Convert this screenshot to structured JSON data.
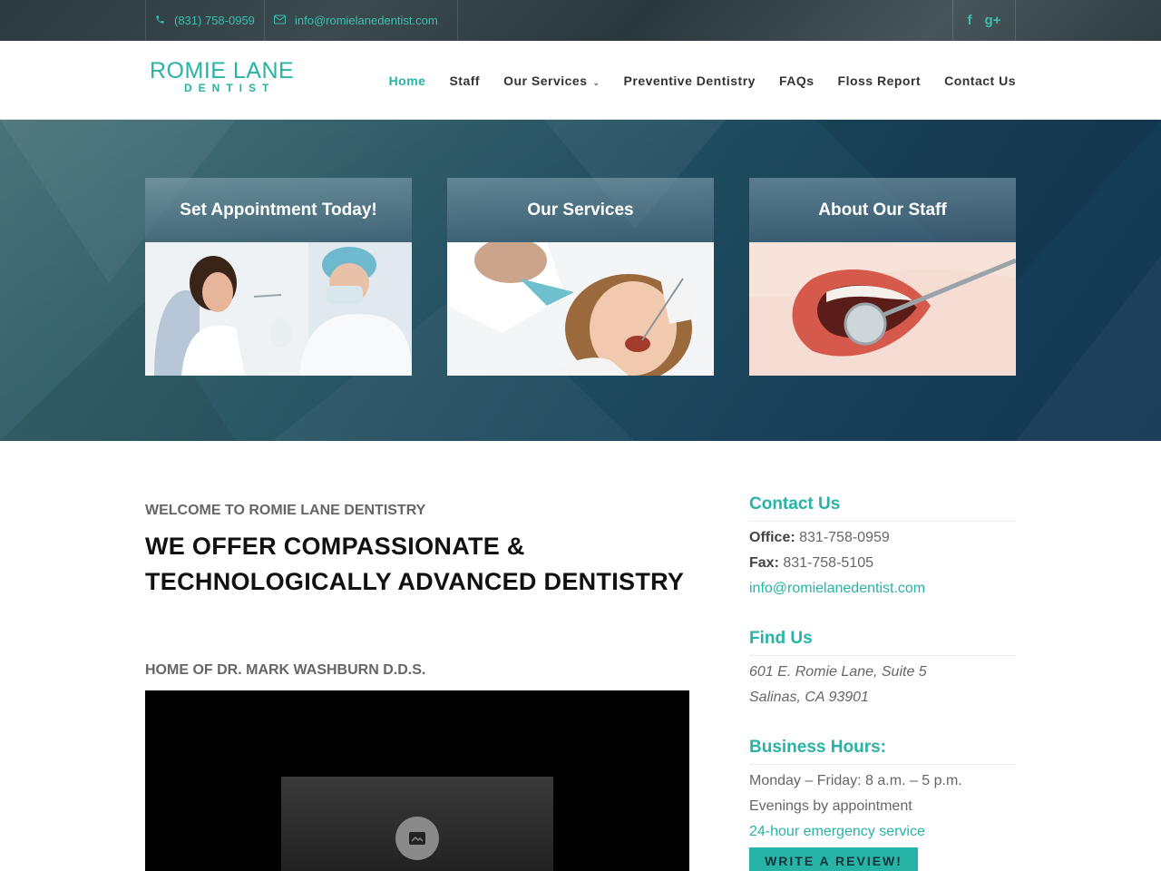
{
  "topbar": {
    "phone": "(831) 758-0959",
    "email": "info@romielanedentist.com",
    "social": [
      "facebook-icon",
      "google-plus-icon"
    ]
  },
  "header": {
    "logo_main": "ROMIE LANE",
    "logo_sub": "DENTIST",
    "nav": [
      {
        "label": "Home",
        "active": true
      },
      {
        "label": "Staff"
      },
      {
        "label": "Our Services",
        "dropdown": true
      },
      {
        "label": "Preventive Dentistry"
      },
      {
        "label": "FAQs"
      },
      {
        "label": "Floss Report"
      },
      {
        "label": "Contact Us"
      }
    ]
  },
  "hero": {
    "cards": [
      {
        "title": "Set Appointment Today!"
      },
      {
        "title": "Our Services"
      },
      {
        "title": "About Our Staff"
      }
    ]
  },
  "main": {
    "kicker": "WELCOME TO ROMIE LANE DENTISTRY",
    "title": "WE OFFER COMPASSIONATE & TECHNOLOGICALLY ADVANCED DENTISTRY",
    "home_of": "HOME OF DR. MARK WASHBURN D.D.S."
  },
  "sidebar": {
    "contact": {
      "heading": "Contact Us",
      "office_label": "Office:",
      "office": "831-758-0959",
      "fax_label": "Fax:",
      "fax": "831-758-5105",
      "email": "info@romielanedentist.com"
    },
    "find": {
      "heading": "Find Us",
      "line1": "601 E. Romie Lane, Suite 5",
      "line2": "Salinas, CA 93901"
    },
    "hours": {
      "heading": "Business Hours:",
      "line1": "Monday – Friday: 8 a.m. – 5 p.m.",
      "line2": "Evenings by appointment",
      "line3": "24-hour emergency service"
    },
    "review_button": "WRITE A REVIEW!"
  },
  "colors": {
    "accent": "#27b3a6",
    "hero_dark": "#123754"
  }
}
